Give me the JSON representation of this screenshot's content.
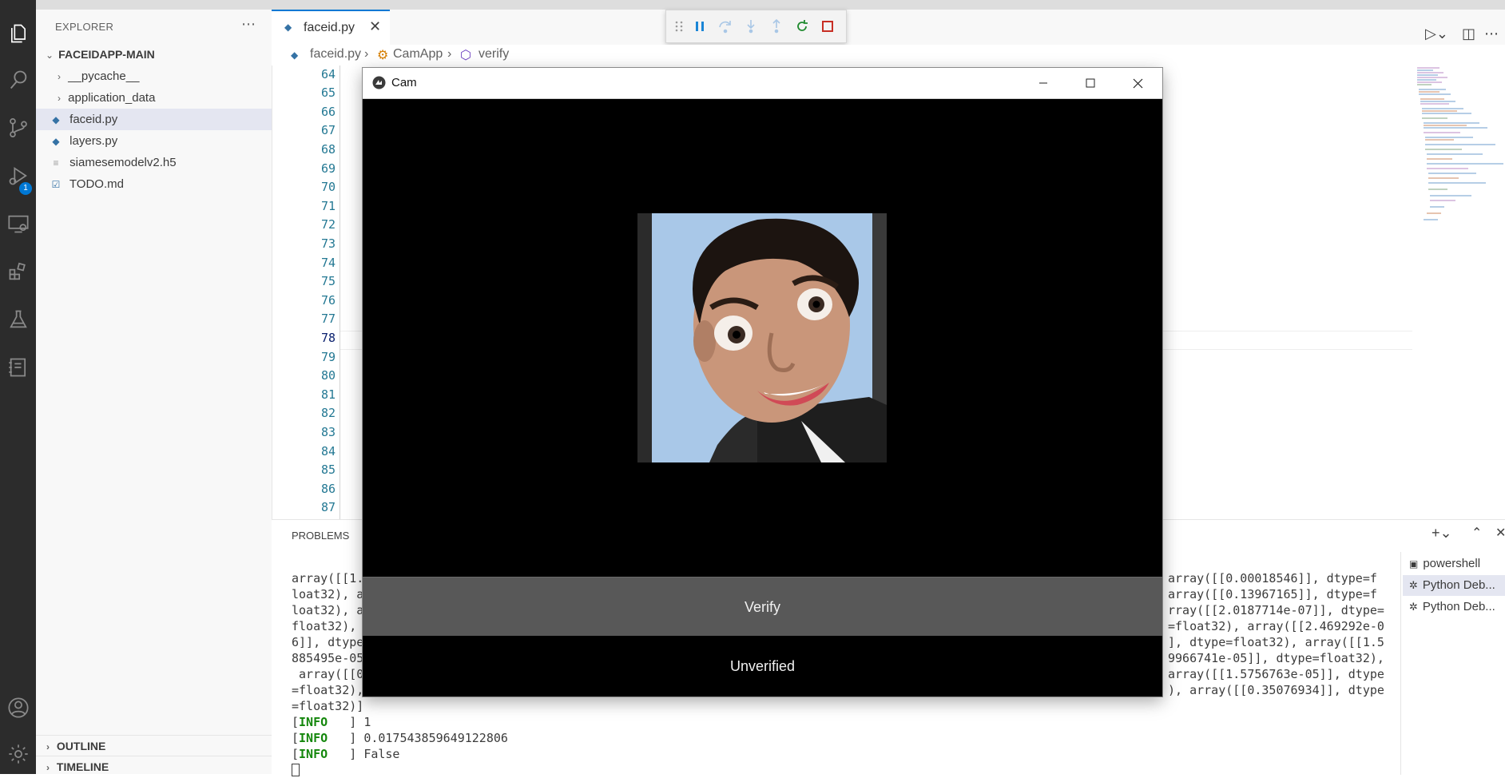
{
  "explorer": {
    "title": "EXPLORER",
    "root": "FACEIDAPP-MAIN",
    "items": [
      {
        "label": "__pycache__"
      },
      {
        "label": "application_data"
      },
      {
        "label": "faceid.py"
      },
      {
        "label": "layers.py"
      },
      {
        "label": "siamesemodelv2.h5"
      },
      {
        "label": "TODO.md"
      }
    ],
    "outline": "OUTLINE",
    "timeline": "TIMELINE"
  },
  "activity": {
    "debug_badge": "1"
  },
  "tab": {
    "label": "faceid.py"
  },
  "breadcrumb": {
    "file": "faceid.py",
    "class": "CamApp",
    "method": "verify"
  },
  "editor": {
    "line_numbers": [
      "64",
      "65",
      "66",
      "67",
      "68",
      "69",
      "70",
      "71",
      "72",
      "73",
      "74",
      "75",
      "76",
      "77",
      "78",
      "79",
      "80",
      "81",
      "82",
      "83",
      "84",
      "85",
      "86",
      "87"
    ],
    "current_line": "78"
  },
  "panel": {
    "tab": "PROBLEMS",
    "terminal_left": [
      "array([[1.",
      "loat32), a",
      "loat32), a",
      "float32),",
      "6]], dtype",
      "885495e-05",
      " array([[0",
      "=float32),",
      "=float32)]"
    ],
    "terminal_right": [
      "array([[0.00018546]], dtype=f",
      "array([[0.13967165]], dtype=f",
      "rray([[2.0187714e-07]], dtype=",
      "=float32), array([[2.469292e-0",
      "], dtype=float32), array([[1.5",
      "9966741e-05]], dtype=float32),",
      "array([[1.5756763e-05]], dtype",
      "), array([[0.35076934]], dtype"
    ],
    "info_tag": "INFO",
    "info_lines": [
      "1",
      "0.017543859649122806",
      "False"
    ],
    "terminals": [
      "powershell",
      "Python Deb...",
      "Python Deb..."
    ]
  },
  "cam": {
    "title": "Cam",
    "verify_label": "Verify",
    "status_label": "Unverified"
  },
  "colors": {
    "accent": "#0078d4",
    "info_green": "#14870c",
    "verify_button": "#585858"
  }
}
